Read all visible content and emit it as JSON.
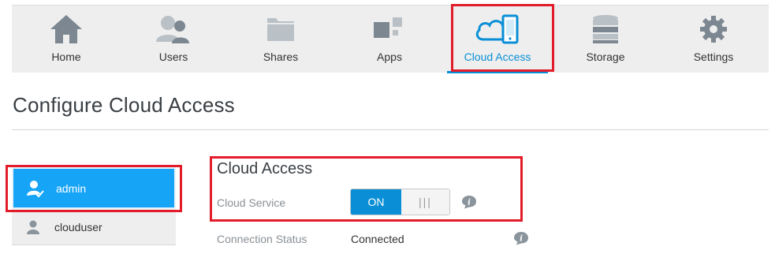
{
  "nav": {
    "items": [
      {
        "label": "Home",
        "icon": "home-icon"
      },
      {
        "label": "Users",
        "icon": "users-icon"
      },
      {
        "label": "Shares",
        "icon": "folder-icon"
      },
      {
        "label": "Apps",
        "icon": "apps-icon"
      },
      {
        "label": "Cloud Access",
        "icon": "cloud-device-icon",
        "active": true
      },
      {
        "label": "Storage",
        "icon": "database-icon"
      },
      {
        "label": "Settings",
        "icon": "gear-icon"
      }
    ]
  },
  "page": {
    "title": "Configure Cloud Access"
  },
  "users": [
    {
      "name": "admin",
      "selected": true
    },
    {
      "name": "clouduser",
      "selected": false
    }
  ],
  "panel": {
    "title": "Cloud Access",
    "cloud_service_label": "Cloud Service",
    "toggle_on_label": "ON",
    "toggle_off_glyph": "|||",
    "connection_status_label": "Connection Status",
    "connection_status_value": "Connected"
  },
  "colors": {
    "accent": "#0a8fd6",
    "selected_row": "#16a4f7",
    "highlight": "#e21c2a",
    "icon_gray": "#7c8791"
  }
}
